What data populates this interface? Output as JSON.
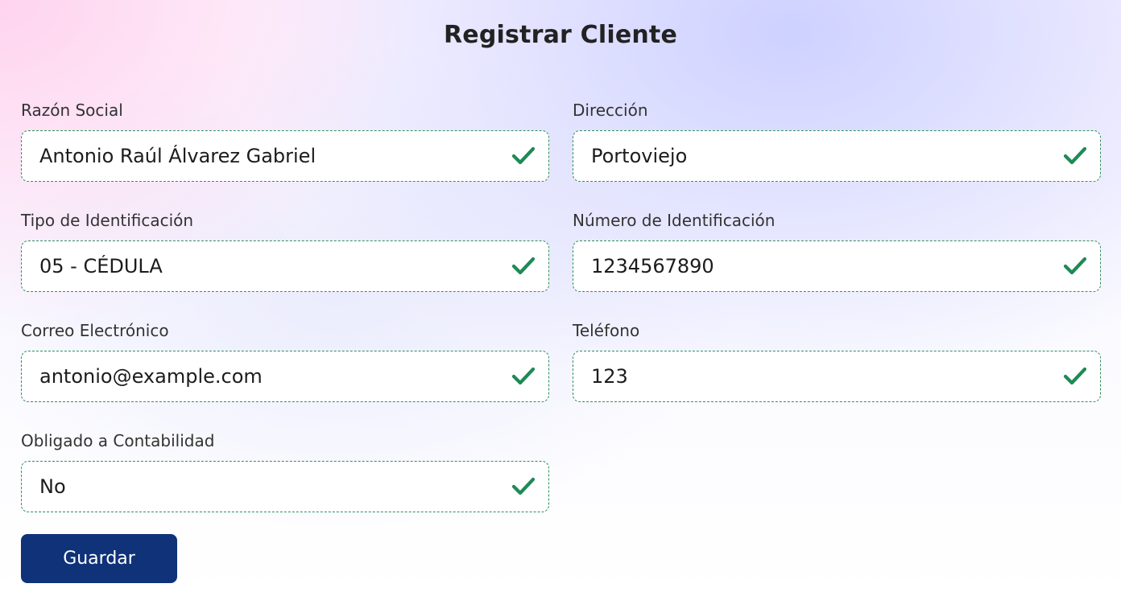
{
  "form": {
    "title": "Registrar Cliente",
    "fields": {
      "razon_social": {
        "label": "Razón Social",
        "value": "Antonio Raúl Álvarez Gabriel"
      },
      "direccion": {
        "label": "Dirección",
        "value": "Portoviejo"
      },
      "tipo_identificacion": {
        "label": "Tipo de Identificación",
        "value": "05 - CÉDULA"
      },
      "numero_identificacion": {
        "label": "Número de Identificación",
        "value": "1234567890"
      },
      "correo": {
        "label": "Correo Electrónico",
        "value": "antonio@example.com"
      },
      "telefono": {
        "label": "Teléfono",
        "value": "123"
      },
      "obligado_contabilidad": {
        "label": "Obligado a Contabilidad",
        "value": "No"
      }
    },
    "save_label": "Guardar"
  },
  "icons": {
    "valid": "check-icon"
  },
  "colors": {
    "primary_button": "#0f3278",
    "valid_border": "#2f8f5b",
    "valid_check": "#1e8a55"
  }
}
